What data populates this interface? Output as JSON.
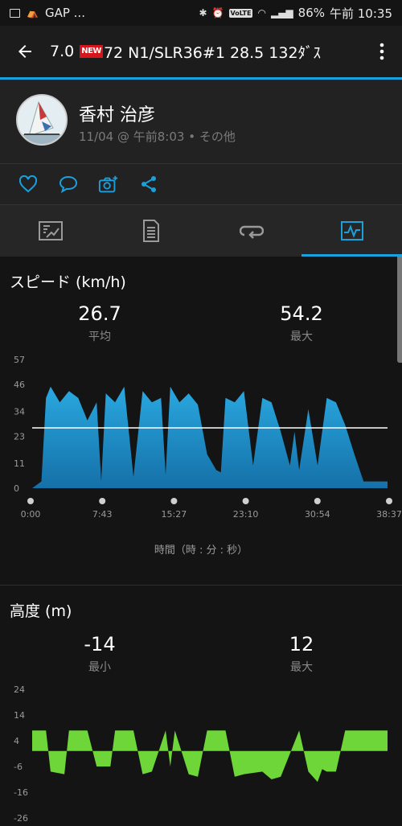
{
  "status_bar": {
    "left_text": "GAP ...",
    "battery": "86%",
    "time": "午前 10:35",
    "volte": "VoLTE"
  },
  "app_bar": {
    "title_prefix": "7.0",
    "new_badge": "NEW",
    "title_suffix": "72 N1/SLR36#1  28.5  132ﾀﾞｽ"
  },
  "profile": {
    "name": "香村 治彦",
    "date": "11/04 @ 午前8:03 • その他"
  },
  "speed": {
    "title": "スピード (km/h)",
    "avg_value": "26.7",
    "avg_label": "平均",
    "max_value": "54.2",
    "max_label": "最大",
    "x_caption": "時間（時 : 分 : 秒）"
  },
  "altitude": {
    "title": "高度 (m)",
    "min_value": "-14",
    "min_label": "最小",
    "max_value": "12",
    "max_label": "最大"
  },
  "colors": {
    "accent": "#1aa0dc",
    "speed_fill": "#1e9ad6",
    "altitude_fill": "#6fd63a"
  },
  "chart_data": [
    {
      "type": "area",
      "ylabel": "",
      "y_ticks": [
        0,
        11,
        23,
        34,
        46,
        57
      ],
      "ylim": [
        0,
        57
      ],
      "x_ticks": [
        "0:00",
        "7:43",
        "15:27",
        "23:10",
        "30:54",
        "38:37"
      ],
      "average_line": 26.7,
      "x_minutes": [
        0,
        1,
        1.5,
        2,
        3,
        4,
        5,
        6,
        7,
        7.5,
        8,
        9,
        10,
        11,
        12,
        13,
        14,
        14.5,
        15,
        16,
        17,
        18,
        19,
        20,
        20.5,
        21,
        22,
        23,
        24,
        25,
        26,
        27,
        28,
        28.5,
        29,
        30,
        31,
        32,
        33,
        34,
        35,
        36,
        37,
        38.6
      ],
      "values": [
        0,
        3,
        40,
        45,
        38,
        43,
        40,
        30,
        38,
        3,
        42,
        38,
        45,
        5,
        43,
        38,
        40,
        6,
        45,
        38,
        42,
        37,
        15,
        8,
        7,
        40,
        38,
        43,
        10,
        40,
        38,
        25,
        10,
        25,
        8,
        35,
        10,
        40,
        38,
        28,
        15,
        3,
        3,
        3
      ]
    },
    {
      "type": "area",
      "ylabel": "",
      "y_ticks": [
        -26,
        -16,
        -6,
        4,
        14,
        24
      ],
      "ylim": [
        -26,
        24
      ],
      "x_minutes": [
        0,
        1.5,
        2,
        3.5,
        4,
        6,
        7,
        8.5,
        9,
        11,
        12,
        13,
        14.5,
        15,
        15.5,
        17,
        18,
        19,
        21,
        22,
        23,
        25,
        26,
        27,
        29,
        30,
        31,
        31.5,
        32,
        33,
        34,
        35,
        36,
        38.6
      ],
      "values": [
        8,
        8,
        -8,
        -9,
        8,
        8,
        -6,
        -6,
        8,
        8,
        -9,
        -8,
        8,
        -6,
        8,
        -9,
        -10,
        8,
        8,
        -10,
        -9,
        -8,
        -11,
        -10,
        8,
        -8,
        -12,
        -7,
        -8,
        -8,
        8,
        8,
        8,
        8
      ]
    }
  ]
}
